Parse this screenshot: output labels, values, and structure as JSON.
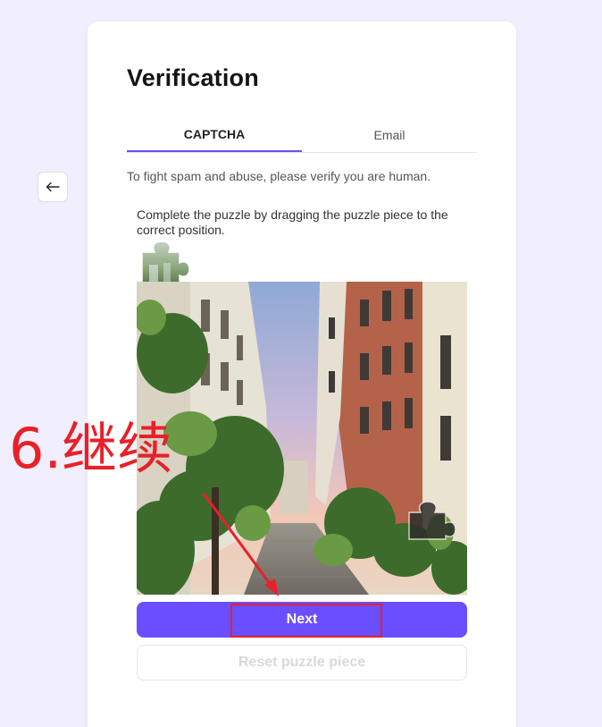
{
  "back_button": {
    "icon": "arrow-left-icon"
  },
  "card": {
    "title": "Verification",
    "tabs": [
      {
        "label": "CAPTCHA",
        "active": true
      },
      {
        "label": "Email",
        "active": false
      }
    ],
    "intro_text": "To fight spam and abuse, please verify you are human.",
    "puzzle": {
      "instruction": "Complete the puzzle by dragging the puzzle piece to the correct position."
    },
    "buttons": {
      "next_label": "Next",
      "reset_label": "Reset puzzle piece"
    }
  },
  "annotation": {
    "label": "6.继续",
    "color": "#e8202a"
  },
  "colors": {
    "accent": "#6b4eff",
    "background": "#f1effd",
    "annotation": "#e8202a"
  }
}
